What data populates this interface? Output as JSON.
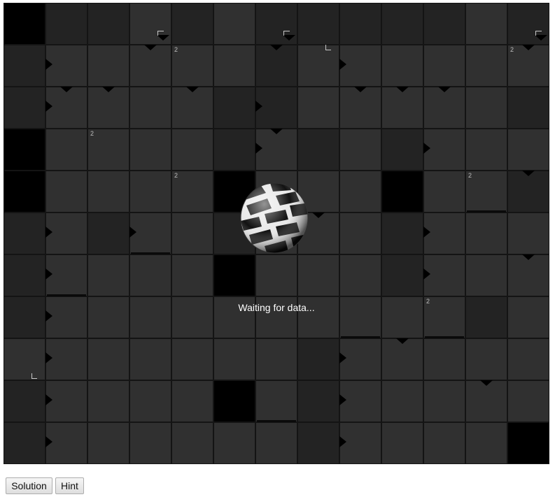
{
  "game": {
    "status_text": "Waiting for data...",
    "grid": {
      "cols": 13,
      "rows": 11,
      "shade_palette": {
        "b": "#000000",
        "d": "#232323",
        "m": "#303030"
      },
      "cells": [
        "bddmdmdddddmd",
        "dmmmmmdmmmmmm",
        "dmmmmddmmmmmd",
        "bmmmmdmdmdmmm",
        "bmmmmbmmmbmmd",
        "dmdmmdmmmdmmm",
        "dmmmmbmmmdmmm",
        "dmmmmmmmmmmdm",
        "mmmmmmmdmmmmm",
        "dmmmmbmdmmmmm",
        "dmmmmmmdmmmmb"
      ]
    },
    "clue_numbers": [
      {
        "row": 1,
        "col": 4,
        "text": "2"
      },
      {
        "row": 1,
        "col": 12,
        "text": "2"
      },
      {
        "row": 3,
        "col": 2,
        "text": "2"
      },
      {
        "row": 4,
        "col": 4,
        "text": "2"
      },
      {
        "row": 4,
        "col": 11,
        "text": "2"
      },
      {
        "row": 7,
        "col": 10,
        "text": "2"
      }
    ],
    "arrows_right": [
      {
        "row": 1,
        "col": 1
      },
      {
        "row": 1,
        "col": 8
      },
      {
        "row": 2,
        "col": 1
      },
      {
        "row": 2,
        "col": 6
      },
      {
        "row": 3,
        "col": 6
      },
      {
        "row": 3,
        "col": 10
      },
      {
        "row": 5,
        "col": 1
      },
      {
        "row": 5,
        "col": 3
      },
      {
        "row": 5,
        "col": 10
      },
      {
        "row": 6,
        "col": 1
      },
      {
        "row": 6,
        "col": 10
      },
      {
        "row": 7,
        "col": 1
      },
      {
        "row": 8,
        "col": 1
      },
      {
        "row": 8,
        "col": 8
      },
      {
        "row": 9,
        "col": 1
      },
      {
        "row": 9,
        "col": 8
      },
      {
        "row": 10,
        "col": 1
      },
      {
        "row": 10,
        "col": 8
      }
    ],
    "arrows_down": [
      {
        "row": 1,
        "col": 3
      },
      {
        "row": 1,
        "col": 6
      },
      {
        "row": 1,
        "col": 12
      },
      {
        "row": 2,
        "col": 1
      },
      {
        "row": 2,
        "col": 2
      },
      {
        "row": 2,
        "col": 4
      },
      {
        "row": 2,
        "col": 8
      },
      {
        "row": 2,
        "col": 9
      },
      {
        "row": 2,
        "col": 10
      },
      {
        "row": 3,
        "col": 6
      },
      {
        "row": 4,
        "col": 12
      },
      {
        "row": 5,
        "col": 7
      },
      {
        "row": 6,
        "col": 12
      },
      {
        "row": 8,
        "col": 9
      },
      {
        "row": 9,
        "col": 11
      }
    ],
    "corner_marks": [
      {
        "row": 1,
        "col": 7,
        "kind": "bottom-left"
      },
      {
        "row": 9,
        "col": 0,
        "kind": "bottom-left"
      },
      {
        "row": 0,
        "col": 3,
        "kind": "top"
      },
      {
        "row": 0,
        "col": 6,
        "kind": "top"
      },
      {
        "row": 0,
        "col": 12,
        "kind": "top"
      }
    ],
    "walls_below": [
      {
        "row": 5,
        "col": 3
      },
      {
        "row": 6,
        "col": 1
      },
      {
        "row": 4,
        "col": 11
      },
      {
        "row": 7,
        "col": 8
      },
      {
        "row": 7,
        "col": 10
      },
      {
        "row": 9,
        "col": 6
      }
    ]
  },
  "controls": {
    "solution_label": "Solution",
    "hint_label": "Hint"
  }
}
